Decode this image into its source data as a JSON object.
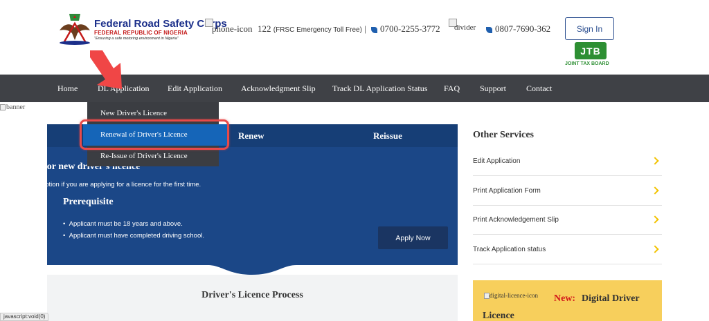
{
  "header": {
    "logo_title": "Federal Road Safety Corps",
    "logo_subtitle": "FEDERAL REPUBLIC OF NIGERIA",
    "logo_motto": "\"Ensuring a safe motoring environment in Nigeria\"",
    "phone_icon_alt": "phone-icon",
    "toll_free_number": "122",
    "toll_free_label": "(FRSC Emergency Toll Free)",
    "separator": "|",
    "phone_2": "0700-2255-3772",
    "divider_alt": "divider",
    "phone_3": "0807-7690-362",
    "signin_label": "Sign In",
    "jtb_mark": "JTB",
    "jtb_label": "JOINT TAX BOARD"
  },
  "nav": {
    "items": [
      {
        "label": "Home"
      },
      {
        "label": "DL Application"
      },
      {
        "label": "Edit Application"
      },
      {
        "label": "Acknowledgment Slip"
      },
      {
        "label": "Track DL Application Status"
      },
      {
        "label": "FAQ"
      },
      {
        "label": "Support"
      },
      {
        "label": "Contact"
      }
    ]
  },
  "dropdown": {
    "items": [
      {
        "label": "New Driver's Licence"
      },
      {
        "label": "Renewal of Driver's Licence",
        "active": true
      },
      {
        "label": "Re-Issue of Driver's Licence"
      }
    ]
  },
  "banner_alt": "banner",
  "panel": {
    "tabs": [
      {
        "label": "Renew"
      },
      {
        "label": "Reissue"
      }
    ],
    "heading": "Apply for new driver's licence",
    "description": "Use this option if you are applying for a licence for the first time.",
    "prereq_heading": "Prerequisite",
    "bullets": [
      "Applicant must be 18 years and above.",
      "Applicant must have completed driving school."
    ],
    "apply_label": "Apply Now"
  },
  "process_title": "Driver's Licence Process",
  "sidebar": {
    "title": "Other Services",
    "services": [
      {
        "label": "Edit Application"
      },
      {
        "label": "Print Application Form"
      },
      {
        "label": "Print Acknowledgement Slip"
      },
      {
        "label": "Track Application status"
      }
    ],
    "digital_icon_alt": "digital-licence-icon",
    "digital_new": "New:",
    "digital_title_line1": "Digital Driver",
    "digital_title_line2": "Licence"
  },
  "status_bar": "javascript:void(0)",
  "colors": {
    "nav_bg": "#3f4146",
    "panel_bg": "#1b4787",
    "active_item": "#1565b8",
    "highlight_red": "#e84a4a",
    "accent_yellow": "#f2c200",
    "digital_bg": "#f7cf5c"
  }
}
